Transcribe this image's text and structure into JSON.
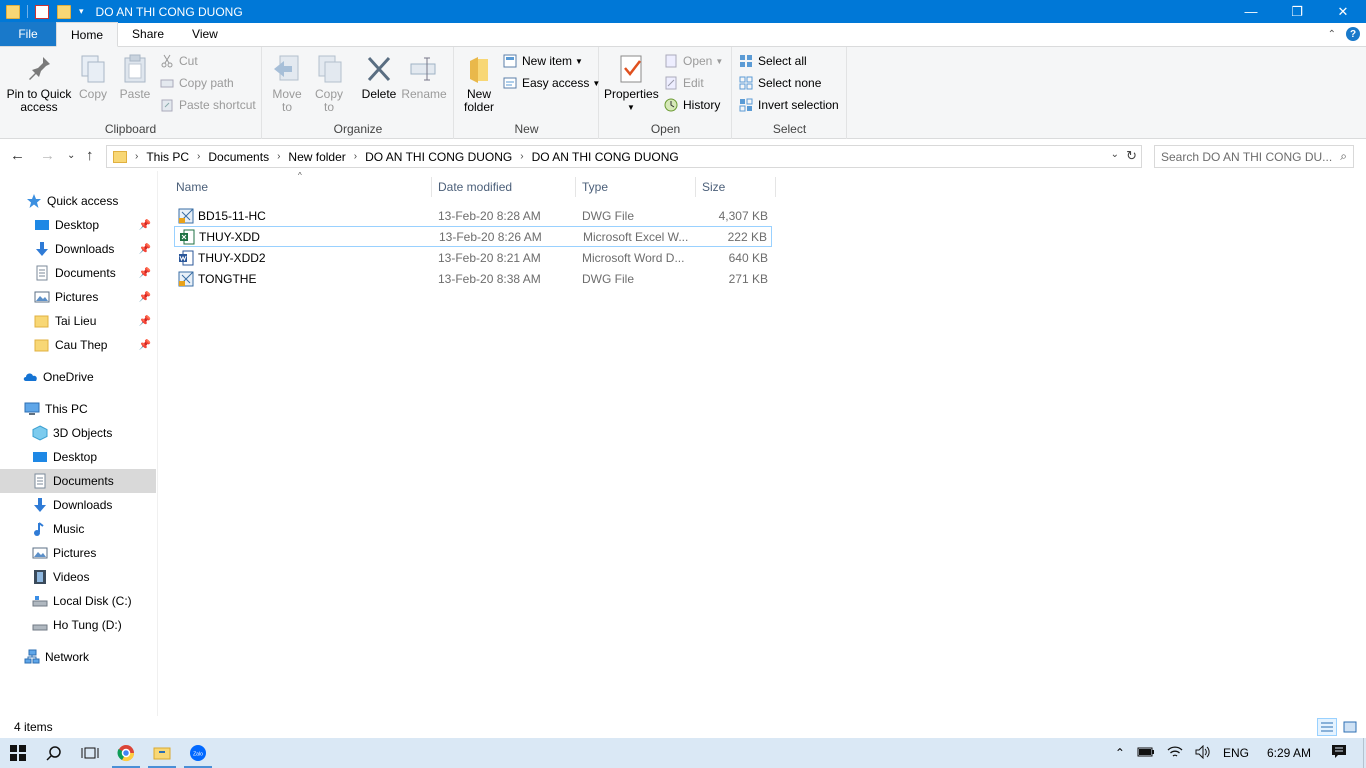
{
  "window": {
    "title": "DO AN THI CONG DUONG",
    "minimize": "—",
    "maximize": "❐",
    "close": "✕"
  },
  "ribbon_tabs": {
    "file": "File",
    "home": "Home",
    "share": "Share",
    "view": "View"
  },
  "ribbon": {
    "clipboard": {
      "label": "Clipboard",
      "pin_quick_access": "Pin to Quick access",
      "copy": "Copy",
      "paste": "Paste",
      "cut": "Cut",
      "copy_path": "Copy path",
      "paste_shortcut": "Paste shortcut"
    },
    "organize": {
      "label": "Organize",
      "move_to": "Move to",
      "copy_to": "Copy to",
      "delete": "Delete",
      "rename": "Rename"
    },
    "new": {
      "label": "New",
      "new_folder": "New folder",
      "new_item": "New item",
      "easy_access": "Easy access"
    },
    "open": {
      "label": "Open",
      "properties": "Properties",
      "open": "Open",
      "edit": "Edit",
      "history": "History"
    },
    "select": {
      "label": "Select",
      "select_all": "Select all",
      "select_none": "Select none",
      "invert_selection": "Invert selection"
    }
  },
  "address": {
    "crumbs": [
      "This PC",
      "Documents",
      "New folder",
      "DO AN THI CONG DUONG",
      "DO AN THI CONG DUONG"
    ],
    "search_placeholder": "Search DO AN THI CONG DU..."
  },
  "nav": {
    "quick_access": "Quick access",
    "quick_items": [
      "Desktop",
      "Downloads",
      "Documents",
      "Pictures",
      "Tai Lieu",
      "Cau Thep"
    ],
    "onedrive": "OneDrive",
    "this_pc": "This PC",
    "pc_items": [
      "3D Objects",
      "Desktop",
      "Documents",
      "Downloads",
      "Music",
      "Pictures",
      "Videos",
      "Local Disk (C:)",
      "Ho Tung (D:)"
    ],
    "network": "Network",
    "selected": "Documents"
  },
  "columns": {
    "name": "Name",
    "date": "Date modified",
    "type": "Type",
    "size": "Size"
  },
  "files": [
    {
      "name": "BD15-11-HC",
      "date": "13-Feb-20 8:28 AM",
      "type": "DWG File",
      "size": "4,307 KB",
      "icon": "dwg-file-icon"
    },
    {
      "name": "THUY-XDD",
      "date": "13-Feb-20 8:26 AM",
      "type": "Microsoft Excel W...",
      "size": "222 KB",
      "icon": "excel-file-icon"
    },
    {
      "name": "THUY-XDD2",
      "date": "13-Feb-20 8:21 AM",
      "type": "Microsoft Word D...",
      "size": "640 KB",
      "icon": "word-file-icon"
    },
    {
      "name": "TONGTHE",
      "date": "13-Feb-20 8:38 AM",
      "type": "DWG File",
      "size": "271 KB",
      "icon": "dwg-file-icon"
    }
  ],
  "status": {
    "count": "4 items"
  },
  "taskbar": {
    "language": "ENG",
    "time": "6:29 AM"
  },
  "colors": {
    "accent": "#0078d7",
    "ribbon_bg": "#f5f6f7",
    "taskbar_bg": "#dae8f5",
    "folder": "#f8d775"
  }
}
